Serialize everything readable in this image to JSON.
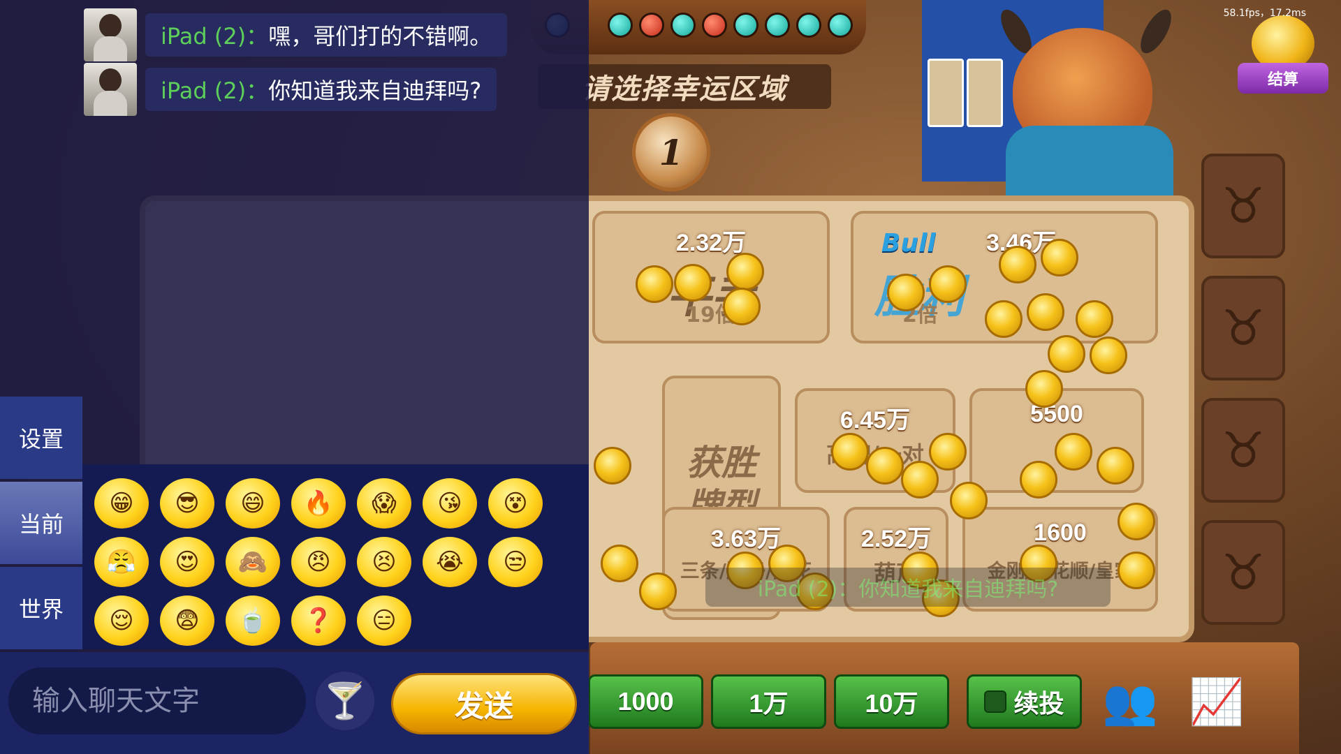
{
  "status": {
    "fps": "58.1fps，17.2ms"
  },
  "settle_button": {
    "label": "结算"
  },
  "board": {
    "lucky_title": "请选择幸运区域",
    "timer": "1",
    "zones": {
      "draw": {
        "amount": "2.32万",
        "label": "平手",
        "multiplier": "19倍"
      },
      "bull_win": {
        "tag": "Bull",
        "amount": "3.46万",
        "label": "胜利",
        "multiplier": "2倍"
      },
      "win_hand": {
        "label_line1": "获胜",
        "label_line2": "牌型"
      },
      "high_pair": {
        "amount": "6.45万",
        "label": "高牌/一对"
      },
      "two_pair": {
        "amount": "5500"
      },
      "three_straight_flush": {
        "amount": "3.63万",
        "label": "三条/顺子/同花"
      },
      "fullhouse": {
        "amount": "2.52万",
        "label": "葫芦"
      },
      "quads": {
        "amount": "1600",
        "label": "金刚/同花顺/皇家"
      }
    },
    "toast": "iPad (2)：你知道我来自迪拜吗?"
  },
  "bet_buttons": [
    "1000",
    "1万",
    "10万"
  ],
  "rebet": {
    "label": "续投"
  },
  "chat": {
    "messages": [
      {
        "sender": "iPad (2)：",
        "text": "嘿，哥们打的不错啊。"
      },
      {
        "sender": "iPad (2)：",
        "text": "你知道我来自迪拜吗?"
      }
    ],
    "tabs": [
      "设置",
      "当前",
      "世界"
    ],
    "active_tab": "当前",
    "input_placeholder": "输入聊天文字",
    "send_label": "发送"
  },
  "emojis": [
    "grin-emoji",
    "cool-emoji",
    "smile-emoji",
    "fire-emoji",
    "scream-emoji",
    "kiss-emoji",
    "dizzy-emoji",
    "angry-emoji",
    "love-emoji",
    "shy-emoji",
    "mad-emoji",
    "bully-emoji",
    "cry-emoji",
    "annoyed-emoji",
    "sleepy-emoji",
    "shock-emoji",
    "drink-emoji",
    "confused-emoji",
    "smirk-emoji"
  ],
  "colors": {
    "chat_bg": "#181a46",
    "sender": "#5dcf5a",
    "bet_green": "#3aa034",
    "send_gold": "#f5b400"
  }
}
